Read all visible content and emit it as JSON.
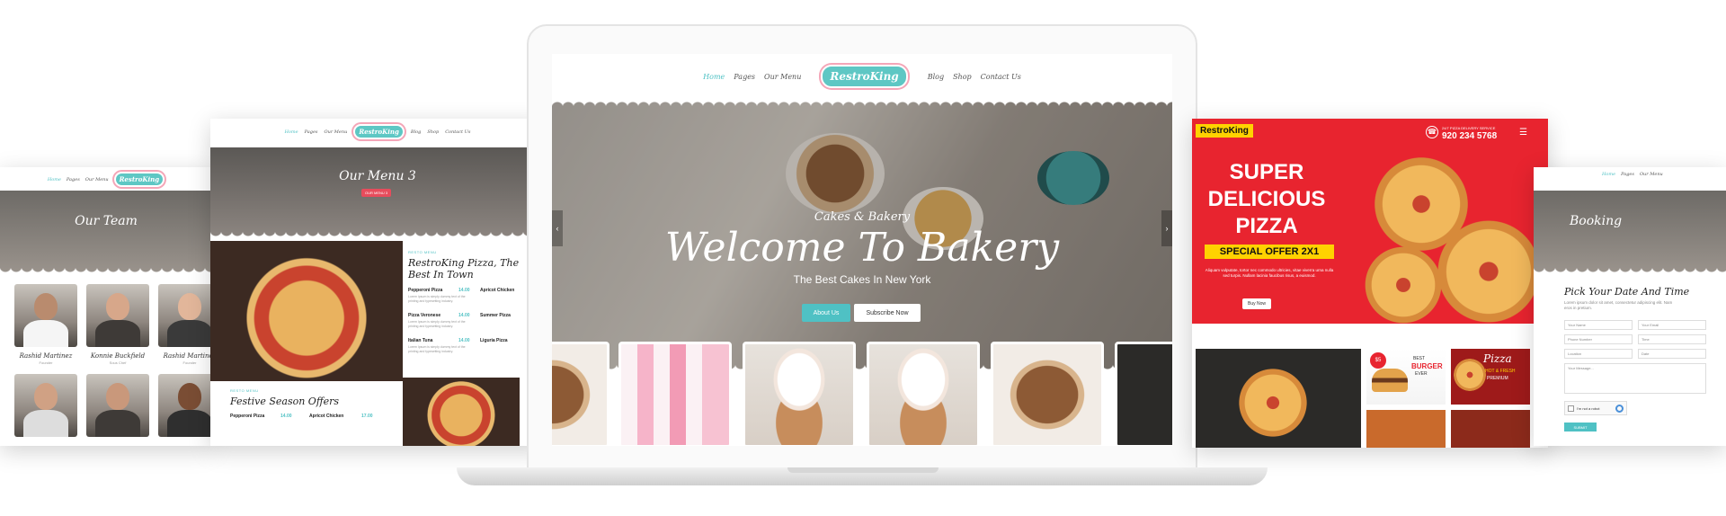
{
  "colors": {
    "accent": "#4fc1c4",
    "pizza_red": "#e8242f",
    "pizza_yellow": "#ffd200",
    "crumb_red": "#e74c5c"
  },
  "team": {
    "nav": [
      "Home",
      "Pages",
      "Our Menu"
    ],
    "logo": "RestroKing",
    "hero_title": "Our Team",
    "members": [
      {
        "name": "Rashid Martinez",
        "role": "Founder"
      },
      {
        "name": "Konnie Buckfield",
        "role": "Sous Chef"
      },
      {
        "name": "Rashid Martinez",
        "role": "Founder"
      }
    ]
  },
  "menu": {
    "nav_left": [
      "Home",
      "Pages",
      "Our Menu"
    ],
    "logo": "RestroKing",
    "nav_right": [
      "Blog",
      "Shop",
      "Contact Us"
    ],
    "hero_title": "Our Menu 3",
    "crumb": "OUR MENU 3",
    "section_label": "RESTO MENU",
    "heading": "RestroKing Pizza, The Best In Town",
    "items_left": [
      {
        "name": "Pepperoni Pizza",
        "price": "14.00",
        "desc": "Lorem Ipsum is simply dummy text of the printing and typesetting industry."
      },
      {
        "name": "Pizza Veronese",
        "price": "14.00",
        "desc": "Lorem Ipsum is simply dummy text of the printing and typesetting industry."
      },
      {
        "name": "Italian Tuna",
        "price": "14.00",
        "desc": "Lorem Ipsum is simply dummy text of the printing and typesetting industry."
      }
    ],
    "items_right": [
      {
        "name": "Apricot Chicken"
      },
      {
        "name": "Summer Pizza"
      },
      {
        "name": "Liguria Pizza"
      }
    ],
    "festive_label": "RESTO MENU",
    "festive_heading": "Festive Season Offers",
    "festive_items": [
      {
        "name": "Pepperoni Pizza",
        "price": "14.00"
      },
      {
        "name": "Apricot Chicken",
        "price": "17.00"
      }
    ]
  },
  "bakery": {
    "nav_left": [
      "Home",
      "Pages",
      "Our Menu"
    ],
    "logo": "RestroKing",
    "nav_right": [
      "Blog",
      "Shop",
      "Contact Us"
    ],
    "subtitle": "Cakes & Bakery",
    "title": "Welcome To Bakery",
    "tagline": "The Best Cakes In New York",
    "about_btn": "About Us",
    "subscribe_btn": "Subscribe Now",
    "prev_arrow": "‹",
    "next_arrow": "›"
  },
  "pizza": {
    "logo": "RestroKing",
    "phone_label": "24/7 PIZZA DELIVERY SERVICE",
    "phone": "920 234 5768",
    "headline": [
      "SUPER",
      "DELICIOUS",
      "PIZZA"
    ],
    "offer": "SPECIAL OFFER 2X1",
    "desc": "Aliquam vulputate, tortor nec commodo ultricies, vitae viverra urna nulla sed turpis. Nullam lacinia faucibus risus, a euismod.",
    "buy_btn": "Buy Now",
    "burger_text": [
      "BEST",
      "BURGER",
      "EVER"
    ],
    "price_badge": "$5",
    "promo": [
      "Pizza",
      "HOT & FRESH",
      "PREMIUM"
    ]
  },
  "booking": {
    "nav": [
      "Home",
      "Pages",
      "Our Menu"
    ],
    "hero_title": "Booking",
    "heading": "Pick Your Date And Time",
    "desc": "Lorem ipsum dolor sit amet, consectetur adipiscing elit. Nam eros in pretium.",
    "fields": [
      "Your Name",
      "Your Email",
      "Phone Number",
      "Time",
      "Location",
      "Date",
      "Your Message..."
    ],
    "captcha": "I'm not a robot",
    "submit": "SUBMIT"
  }
}
